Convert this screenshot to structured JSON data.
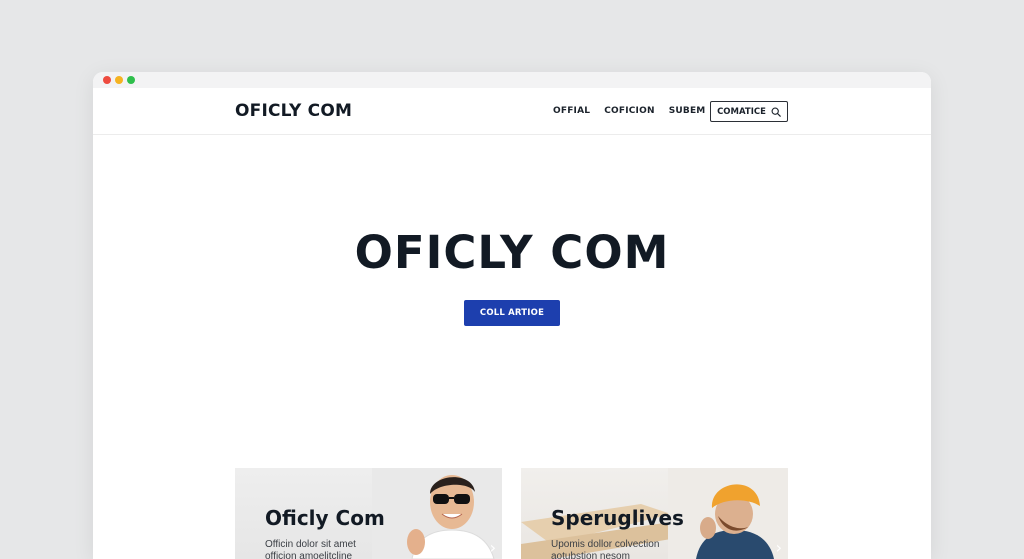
{
  "site": {
    "brand": "OFICLY COM"
  },
  "nav": {
    "links": [
      "OFFIAL",
      "COFICION",
      "SUBEM"
    ],
    "search_label": "COMATICE"
  },
  "hero": {
    "title": "OFICLY COM",
    "button_label": "COLL ARTIOE"
  },
  "cards": [
    {
      "title": "Oficly Com",
      "text": "Officin dolor sit amet officion amoelitcline"
    },
    {
      "title": "Speruglives",
      "text": "Upomis dollor colvection aotubstion nesom"
    }
  ],
  "colors": {
    "accent": "#1d3fae",
    "text": "#121a24",
    "background": "#e6e7e8",
    "window": "#ffffff"
  },
  "icons": {
    "search": "search-icon",
    "card_arrow": "chevron-right-icon"
  }
}
